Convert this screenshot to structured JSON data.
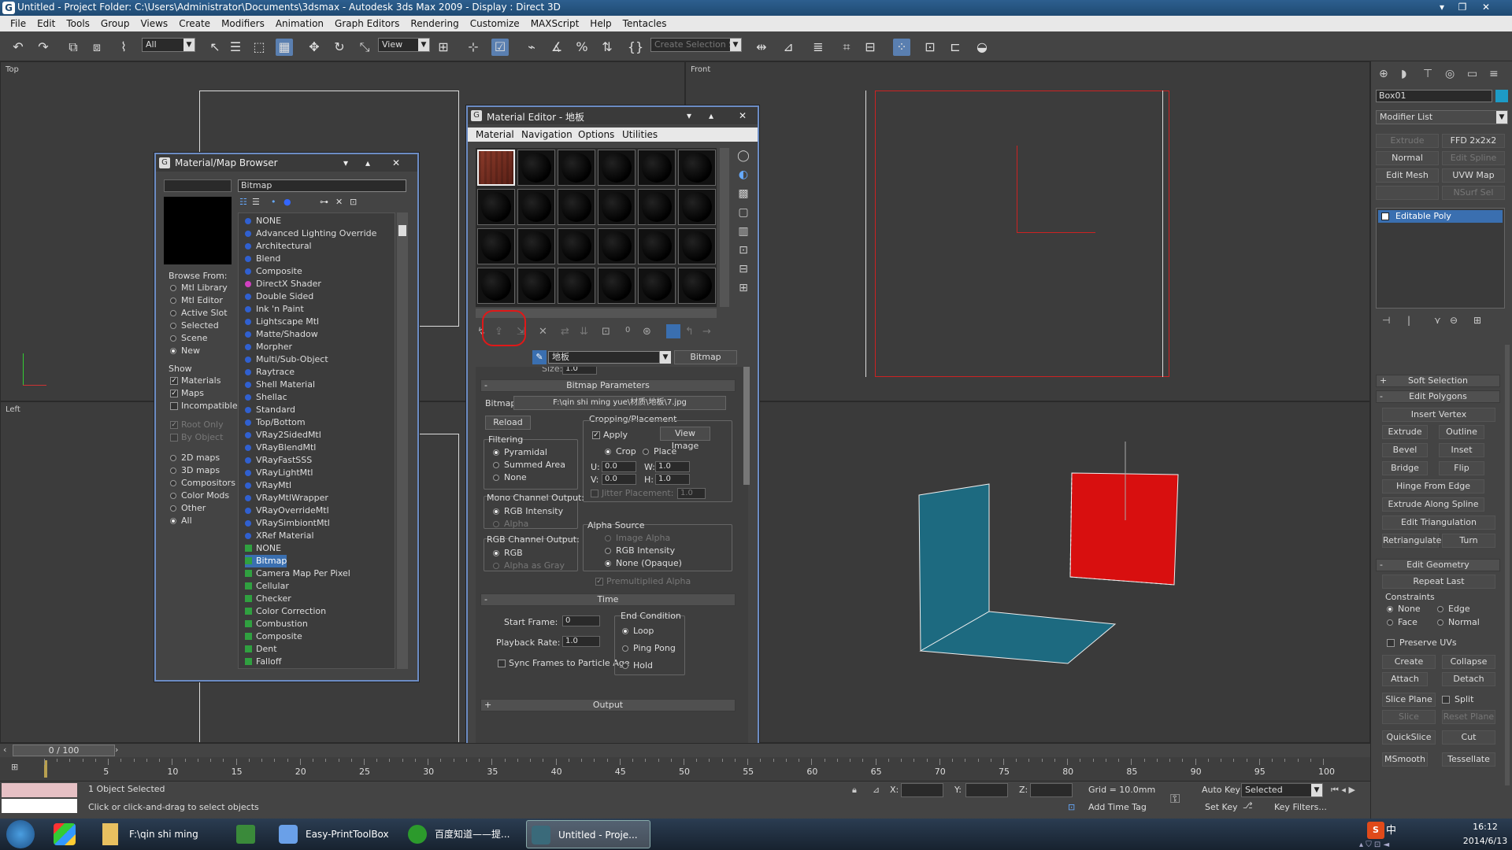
{
  "window": {
    "title": "Untitled     - Project Folder: C:\\Users\\Administrator\\Documents\\3dsmax     - Autodesk 3ds Max  2009      - Display : Direct 3D"
  },
  "menu": [
    "File",
    "Edit",
    "Tools",
    "Group",
    "Views",
    "Create",
    "Modifiers",
    "Animation",
    "Graph Editors",
    "Rendering",
    "Customize",
    "MAXScript",
    "Help",
    "Tentacles"
  ],
  "toolbar": {
    "selection_filter": "All",
    "ref_coord": "View",
    "named_selection_placeholder": "Create Selection Se"
  },
  "viewports": {
    "top": "Top",
    "front": "Front",
    "left": "Left"
  },
  "map_browser": {
    "title": "Material/Map Browser",
    "search": "Bitmap",
    "browse_from_label": "Browse From:",
    "browse_from": [
      "Mtl Library",
      "Mtl Editor",
      "Active Slot",
      "Selected",
      "Scene",
      "New"
    ],
    "show_label": "Show",
    "show": [
      {
        "label": "Materials",
        "checked": true
      },
      {
        "label": "Maps",
        "checked": true
      },
      {
        "label": "Incompatible",
        "checked": false
      }
    ],
    "root_only": "Root Only",
    "by_object": "By Object",
    "map_filters": [
      "2D maps",
      "3D maps",
      "Compositors",
      "Color Mods",
      "Other",
      "All"
    ],
    "materials": [
      "NONE",
      "Advanced Lighting Override",
      "Architectural",
      "Blend",
      "Composite",
      "DirectX Shader",
      "Double Sided",
      "Ink 'n Paint",
      "Lightscape Mtl",
      "Matte/Shadow",
      "Morpher",
      "Multi/Sub-Object",
      "Raytrace",
      "Shell Material",
      "Shellac",
      "Standard",
      "Top/Bottom",
      "VRay2SidedMtl",
      "VRayBlendMtl",
      "VRayFastSSS",
      "VRayLightMtl",
      "VRayMtl",
      "VRayMtlWrapper",
      "VRayOverrideMtl",
      "VRaySimbiontMtl",
      "XRef Material"
    ],
    "maps": [
      "NONE",
      "Bitmap",
      "Camera Map Per Pixel",
      "Cellular",
      "Checker",
      "Color Correction",
      "Combustion",
      "Composite",
      "Dent",
      "Falloff"
    ],
    "selected_map": "Bitmap"
  },
  "material_editor": {
    "title": "Material Editor - 地板",
    "menus": [
      "Material",
      "Navigation",
      "Options",
      "Utilities"
    ],
    "map_name": "地板",
    "map_type": "Bitmap",
    "size_label": "Size:",
    "size_value": "1.0",
    "bitmap_params": {
      "rollout": "Bitmap Parameters",
      "bitmap_label": "Bitmap:",
      "bitmap_path": "F:\\qin shi ming yue\\材质\\地板\\7.jpg",
      "reload": "Reload",
      "cropping_label": "Cropping/Placement",
      "apply": "Apply",
      "view_image": "View Image",
      "crop": "Crop",
      "place": "Place",
      "u_label": "U:",
      "u_value": "0.0",
      "v_label": "V:",
      "v_value": "0.0",
      "w_label": "W:",
      "w_value": "1.0",
      "h_label": "H:",
      "h_value": "1.0",
      "jitter": "Jitter Placement:",
      "jitter_value": "1.0",
      "filtering_label": "Filtering",
      "filtering": [
        "Pyramidal",
        "Summed Area",
        "None"
      ],
      "mono_label": "Mono Channel Output:",
      "mono": [
        "RGB Intensity",
        "Alpha"
      ],
      "rgb_label": "RGB Channel Output:",
      "rgb": [
        "RGB",
        "Alpha as Gray"
      ],
      "alpha_source_label": "Alpha Source",
      "alpha_source": [
        "Image Alpha",
        "RGB Intensity",
        "None (Opaque)"
      ],
      "premultiplied": "Premultiplied Alpha"
    },
    "time": {
      "rollout": "Time",
      "start_frame_label": "Start Frame:",
      "start_frame": "0",
      "playback_label": "Playback Rate:",
      "playback": "1.0",
      "sync": "Sync Frames to Particle Age",
      "end_condition_label": "End Condition",
      "end_condition": [
        "Loop",
        "Ping Pong",
        "Hold"
      ]
    },
    "output_rollout": "Output",
    "slot_count_label": "0"
  },
  "command_panel": {
    "object_name": "Box01",
    "modifier_list": "Modifier List",
    "modifier_buttons": [
      {
        "label": "Extrude",
        "enabled": false
      },
      {
        "label": "FFD 2x2x2",
        "enabled": true
      },
      {
        "label": "Normal",
        "enabled": true
      },
      {
        "label": "Edit Spline",
        "enabled": false
      },
      {
        "label": "Edit Mesh",
        "enabled": true
      },
      {
        "label": "UVW Map",
        "enabled": true
      },
      {
        "label": "",
        "enabled": false
      },
      {
        "label": "NSurf Sel",
        "enabled": false
      }
    ],
    "stack_item": "Editable Poly",
    "rollouts": {
      "soft_selection": "Soft Selection",
      "edit_polygons": "Edit Polygons",
      "insert_vertex": "Insert Vertex",
      "extrude": "Extrude",
      "outline": "Outline",
      "bevel": "Bevel",
      "inset": "Inset",
      "bridge": "Bridge",
      "flip": "Flip",
      "hinge": "Hinge From Edge",
      "extrude_spline": "Extrude Along Spline",
      "edit_triangulation": "Edit Triangulation",
      "retriangulate": "Retriangulate",
      "turn": "Turn",
      "edit_geometry": "Edit Geometry",
      "repeat_last": "Repeat Last",
      "constraints": "Constraints",
      "c_none": "None",
      "c_edge": "Edge",
      "c_face": "Face",
      "c_normal": "Normal",
      "preserve_uvs": "Preserve UVs",
      "create": "Create",
      "collapse": "Collapse",
      "attach": "Attach",
      "detach": "Detach",
      "slice_plane": "Slice Plane",
      "split": "Split",
      "slice": "Slice",
      "reset_plane": "Reset Plane",
      "quickslice": "QuickSlice",
      "cut": "Cut",
      "msmooth": "MSmooth",
      "tessellate": "Tessellate"
    }
  },
  "timeline": {
    "frame": "0 / 100",
    "ticks": [
      "5",
      "10",
      "15",
      "20",
      "25",
      "30",
      "35",
      "40",
      "45",
      "50",
      "55",
      "60",
      "65",
      "70",
      "75",
      "80",
      "85",
      "90",
      "95",
      "100"
    ]
  },
  "status": {
    "selected": "1 Object Selected",
    "prompt": "Click or click-and-drag to select objects",
    "x_label": "X:",
    "y_label": "Y:",
    "z_label": "Z:",
    "grid": "Grid = 10.0mm",
    "auto_key": "Auto Key",
    "set_key": "Set Key",
    "key_mode": "Selected",
    "key_filters": "Key Filters...",
    "add_time_tag": "Add Time Tag"
  },
  "taskbar": {
    "items": [
      "F:\\qin shi ming yue",
      "Easy-PrintToolBox",
      "百度知道——提...",
      "Untitled     - Proje..."
    ],
    "time": "16:12",
    "date": "2014/6/13",
    "ime": "中"
  }
}
